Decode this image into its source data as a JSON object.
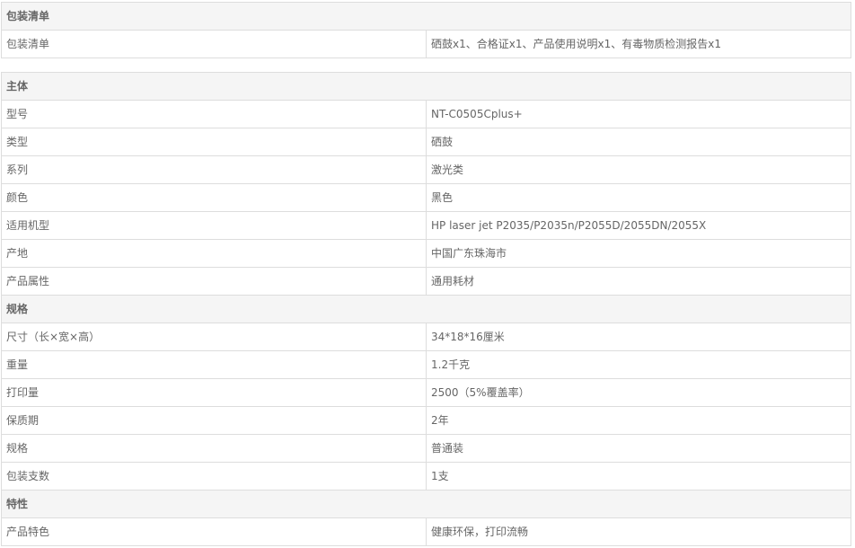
{
  "packing": {
    "header": "包装清单",
    "rows": [
      {
        "key": "包装清单",
        "value": "硒鼓x1、合格证x1、产品使用说明x1、有毒物质检测报告x1"
      }
    ]
  },
  "main": {
    "header": "主体",
    "rows": [
      {
        "key": "型号",
        "value": "NT-C0505Cplus+"
      },
      {
        "key": "类型",
        "value": "硒鼓"
      },
      {
        "key": "系列",
        "value": "激光类"
      },
      {
        "key": "颜色",
        "value": "黑色"
      },
      {
        "key": "适用机型",
        "value": "HP laser jet P2035/P2035n/P2055D/2055DN/2055X"
      },
      {
        "key": "产地",
        "value": "中国广东珠海市"
      },
      {
        "key": "产品属性",
        "value": "通用耗材"
      }
    ]
  },
  "spec": {
    "header": "规格",
    "rows": [
      {
        "key": "尺寸（长×宽×高）",
        "value": "34*18*16厘米"
      },
      {
        "key": "重量",
        "value": "1.2千克"
      },
      {
        "key": "打印量",
        "value": "2500（5%覆盖率）"
      },
      {
        "key": "保质期",
        "value": "2年"
      },
      {
        "key": "规格",
        "value": "普通装"
      },
      {
        "key": "包装支数",
        "value": "1支"
      }
    ]
  },
  "features": {
    "header": "特性",
    "rows": [
      {
        "key": "产品特色",
        "value": "健康环保，打印流畅"
      }
    ]
  }
}
